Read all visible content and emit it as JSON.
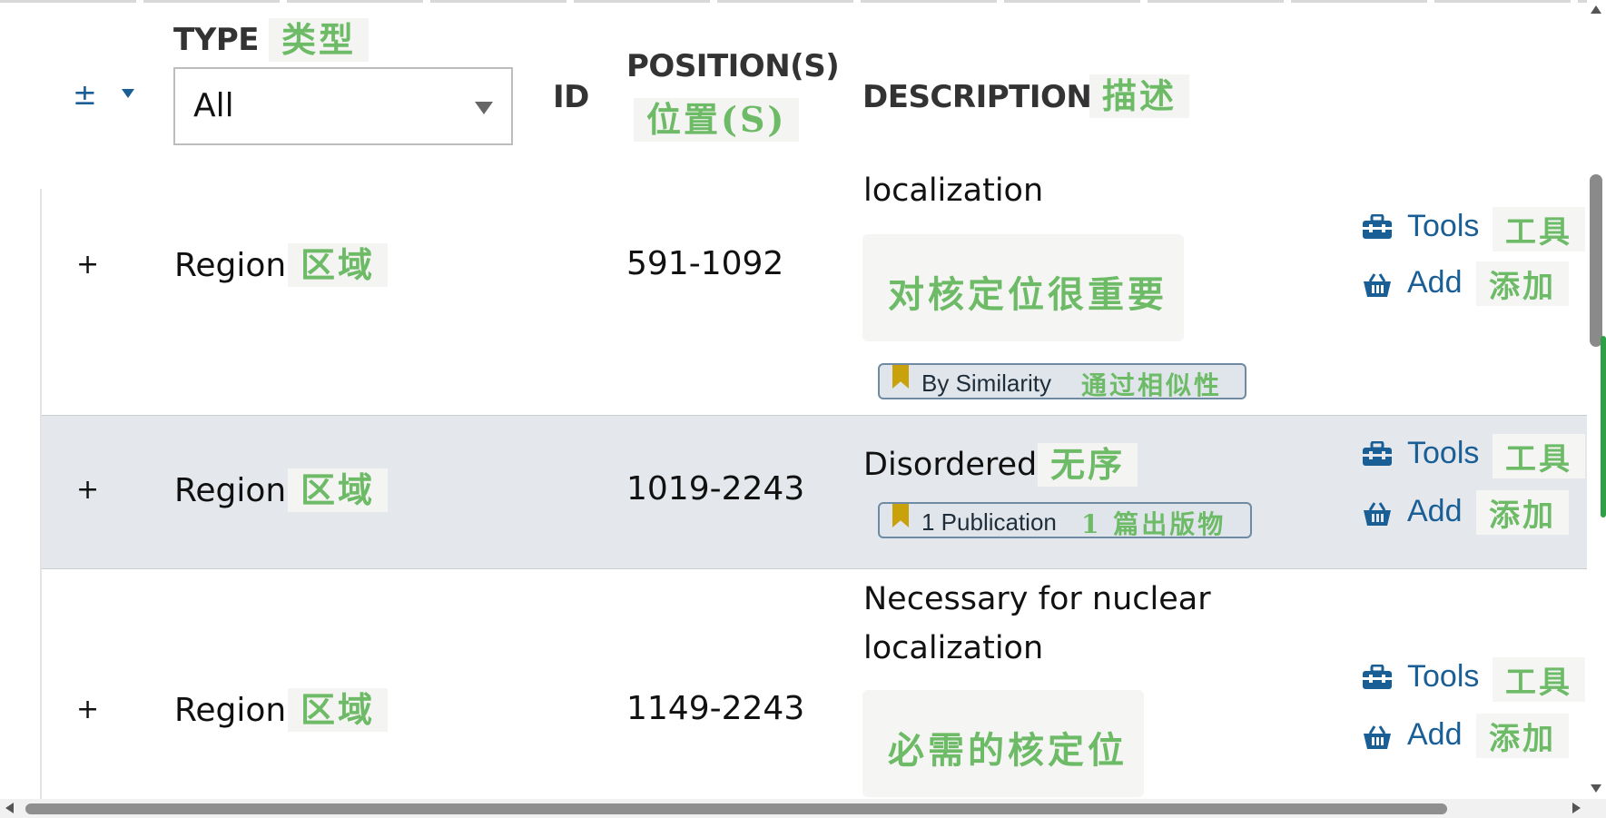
{
  "header": {
    "expand_icon": "expand-all-icon",
    "type_label": "TYPE",
    "type_label_zh": "类型",
    "type_filter_value": "All",
    "id_label": "ID",
    "position_label": "POSITION(S)",
    "position_label_zh": "位置(S)",
    "description_label": "DESCRIPTION",
    "description_label_zh": "描述"
  },
  "rows": [
    {
      "expand": "+",
      "type": "Region",
      "type_zh": "区域",
      "position": "591-1092",
      "description_lines": [
        "localization"
      ],
      "description_zh": "对核定位很重要",
      "evidence": "By Similarity",
      "evidence_zh": "通过相似性",
      "tools_label": "Tools",
      "tools_zh": "工具",
      "add_label": "Add",
      "add_zh": "添加"
    },
    {
      "expand": "+",
      "type": "Region",
      "type_zh": "区域",
      "position": "1019-2243",
      "description_lines": [
        "Disordered"
      ],
      "description_zh": "无序",
      "evidence": "1 Publication",
      "evidence_zh": "1 篇出版物",
      "tools_label": "Tools",
      "tools_zh": "工具",
      "add_label": "Add",
      "add_zh": "添加"
    },
    {
      "expand": "+",
      "type": "Region",
      "type_zh": "区域",
      "position": "1149-2243",
      "description_lines": [
        "Necessary for nuclear",
        "localization"
      ],
      "description_zh": "必需的核定位",
      "tools_label": "Tools",
      "tools_zh": "工具",
      "add_label": "Add",
      "add_zh": "添加"
    }
  ],
  "colors": {
    "link": "#1a5e96",
    "annotation_green": "#6dba67",
    "highlight_row": "#e4e8ec",
    "evidence_tag": "#dfe5ea",
    "bookmark": "#c9a20b"
  }
}
